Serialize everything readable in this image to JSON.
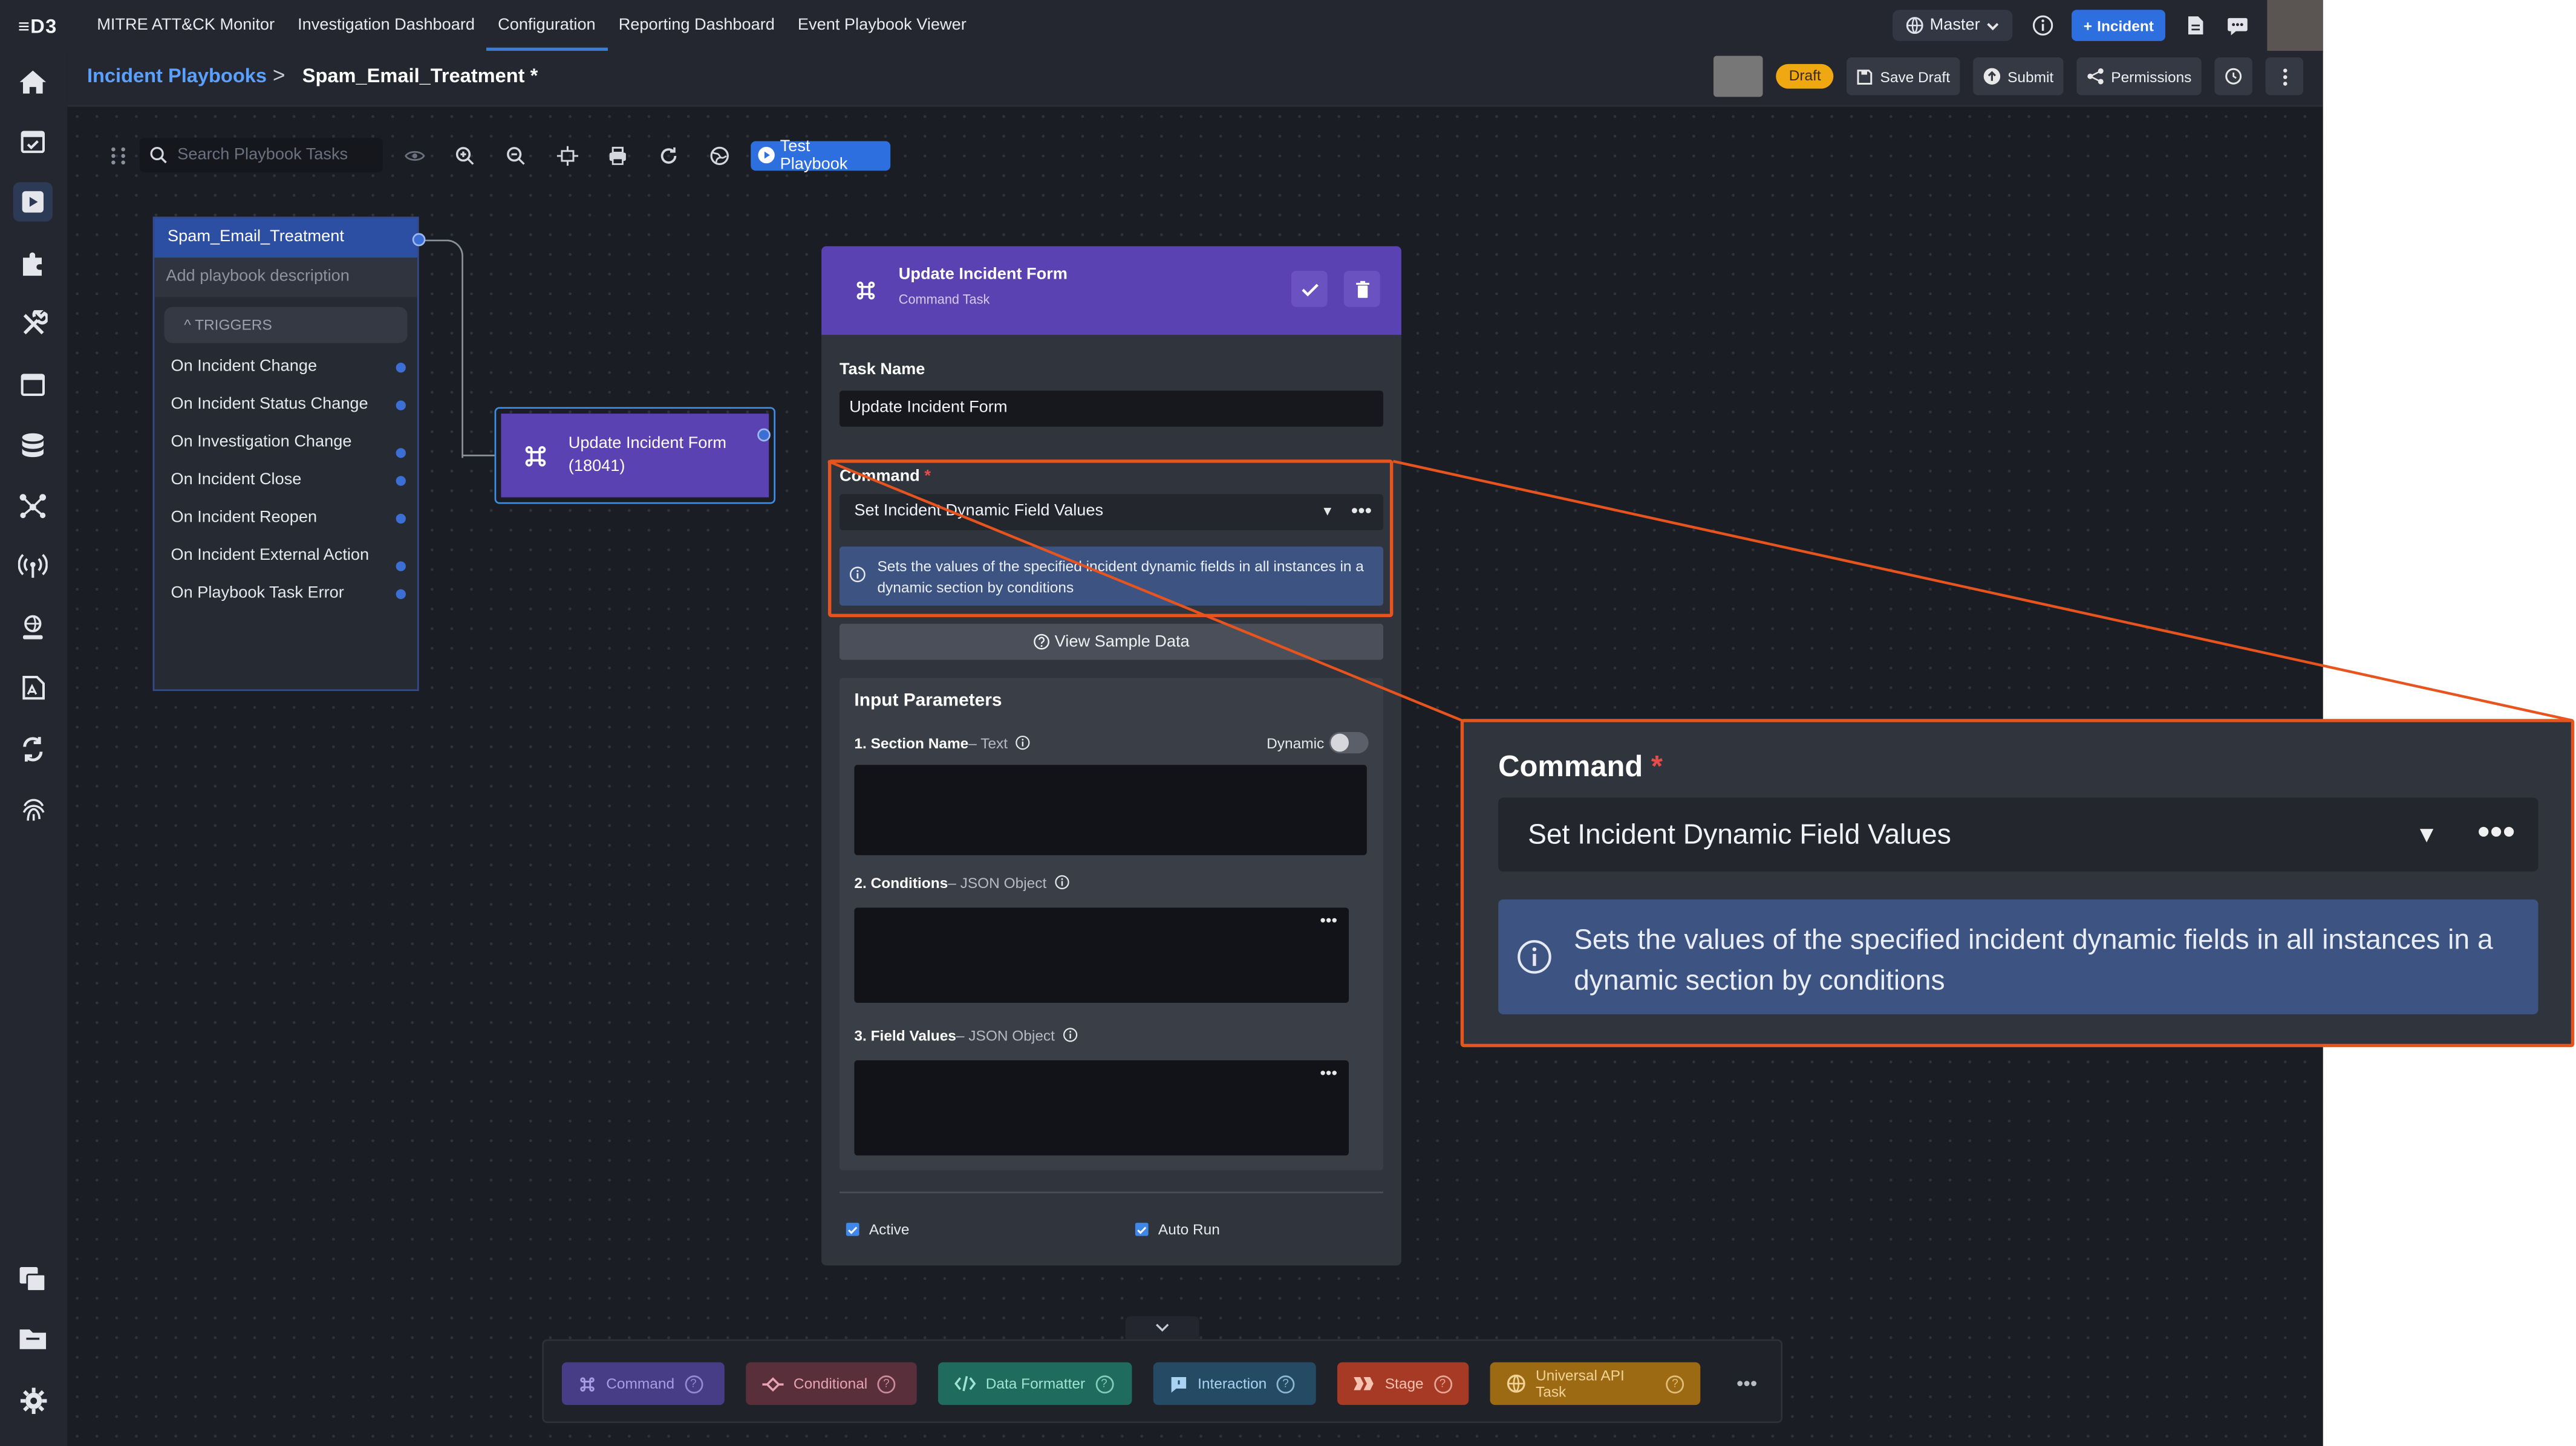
{
  "app": {
    "logo": "≡D3",
    "nav": [
      "MITRE ATT&CK Monitor",
      "Investigation Dashboard",
      "Configuration",
      "Reporting Dashboard",
      "Event Playbook Viewer"
    ],
    "active_nav": "Configuration",
    "site_selector": "Master",
    "incident_button": "Incident",
    "colors": {
      "accent": "#2e6fe0",
      "task_purple": "#5b42b3",
      "highlight": "#e8541e",
      "draft": "#f0a812"
    }
  },
  "sidebar": {
    "icons": [
      "home-icon",
      "calendar-check-icon",
      "playbook-icon",
      "puzzle-icon",
      "tools-icon",
      "calendar-icon",
      "database-icon",
      "graph-icon",
      "antenna-icon",
      "user-globe-icon",
      "report-icon",
      "sync-icon",
      "fingerprint-icon",
      "copy-icon",
      "folder-icon",
      "gear-icon"
    ],
    "active": "playbook-icon"
  },
  "breadcrumb": {
    "parent": "Incident Playbooks",
    "separator": ">",
    "current": "Spam_Email_Treatment *",
    "status_badge": "Draft",
    "save_draft": "Save Draft",
    "submit": "Submit",
    "permissions": "Permissions"
  },
  "toolbar": {
    "search_placeholder": "Search Playbook Tasks",
    "test_button": "Test Playbook"
  },
  "trigger_node": {
    "title": "Spam_Email_Treatment",
    "description_placeholder": "Add playbook description",
    "triggers_label": "TRIGGERS",
    "triggers": [
      "On Incident Change",
      "On Incident Status Change",
      "On Investigation Change",
      "On Incident Close",
      "On Incident Reopen",
      "On Incident External Action",
      "On Playbook Task Error"
    ]
  },
  "task_node": {
    "title": "Update Incident Form",
    "id": "(18041)"
  },
  "panel": {
    "title": "Update Incident Form",
    "subtitle": "Command Task",
    "task_name_label": "Task Name",
    "task_name_value": "Update Incident Form",
    "command_label": "Command",
    "required_mark": "*",
    "command_value": "Set Incident Dynamic Field Values",
    "command_description": "Sets the values of the specified incident dynamic fields in all instances in a dynamic section by conditions",
    "sample_button": "View Sample Data",
    "params_title": "Input Parameters",
    "dynamic_label": "Dynamic",
    "params": [
      {
        "name": "1. Section Name",
        "type": "– Text"
      },
      {
        "name": "2. Conditions",
        "type": "– JSON Object"
      },
      {
        "name": "3. Field Values",
        "type": "– JSON Object"
      }
    ],
    "active_label": "Active",
    "active_checked": true,
    "auto_run_label": "Auto Run",
    "auto_run_checked": true
  },
  "task_types": [
    {
      "label": "Command",
      "bg": "#463d86",
      "fg": "#a79de4"
    },
    {
      "label": "Conditional",
      "bg": "#5a2f3c",
      "fg": "#e7a2b3"
    },
    {
      "label": "Data Formatter",
      "bg": "#1f6b5e",
      "fg": "#9fe3d2"
    },
    {
      "label": "Interaction",
      "bg": "#254a64",
      "fg": "#a9d3f2"
    },
    {
      "label": "Stage",
      "bg": "#a63a24",
      "fg": "#f7c2b2"
    },
    {
      "label": "Universal API Task",
      "bg": "#9c6a12",
      "fg": "#f2d397"
    }
  ],
  "zoom": {
    "command_label": "Command",
    "required_mark": "*",
    "command_value": "Set Incident Dynamic Field Values",
    "command_description": "Sets the values of the specified incident dynamic fields in all instances in a dynamic section by conditions"
  }
}
